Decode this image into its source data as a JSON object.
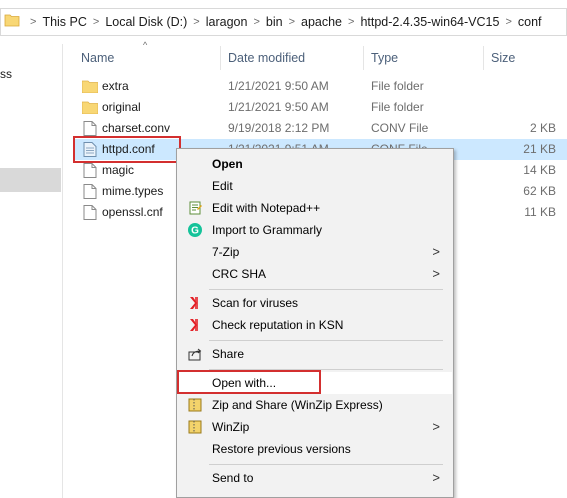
{
  "breadcrumb": [
    "This PC",
    "Local Disk (D:)",
    "laragon",
    "bin",
    "apache",
    "httpd-2.4.35-win64-VC15",
    "conf"
  ],
  "nav": {
    "partial_text": "ss"
  },
  "columns": {
    "name": "Name",
    "date": "Date modified",
    "type": "Type",
    "size": "Size"
  },
  "files": [
    {
      "name": "extra",
      "date": "1/21/2021 9:50 AM",
      "type": "File folder",
      "size": "",
      "kind": "folder"
    },
    {
      "name": "original",
      "date": "1/21/2021 9:50 AM",
      "type": "File folder",
      "size": "",
      "kind": "folder"
    },
    {
      "name": "charset.conv",
      "date": "9/19/2018 2:12 PM",
      "type": "CONV File",
      "size": "2 KB",
      "kind": "file"
    },
    {
      "name": "httpd.conf",
      "date": "1/21/2021 9:51 AM",
      "type": "CONF File",
      "size": "21 KB",
      "kind": "conf",
      "selected": true
    },
    {
      "name": "magic",
      "date": "",
      "type": "",
      "size": "14 KB",
      "kind": "file"
    },
    {
      "name": "mime.types",
      "date": "",
      "type": "",
      "size": "62 KB",
      "kind": "file"
    },
    {
      "name": "openssl.cnf",
      "date": "",
      "type": "",
      "size": "11 KB",
      "kind": "file"
    }
  ],
  "context_menu": {
    "open": "Open",
    "edit": "Edit",
    "edit_notepad": "Edit with Notepad++",
    "grammarly": "Import to Grammarly",
    "sevenzip": "7-Zip",
    "crc": "CRC SHA",
    "scan": "Scan for viruses",
    "ksn": "Check reputation in KSN",
    "share": "Share",
    "open_with": "Open with...",
    "zip_share": "Zip and Share (WinZip Express)",
    "winzip": "WinZip",
    "restore": "Restore previous versions",
    "send_to": "Send to"
  },
  "colors": {
    "highlight": "#d32f2f",
    "selection": "#cce8ff",
    "folder": "#f8d775"
  }
}
